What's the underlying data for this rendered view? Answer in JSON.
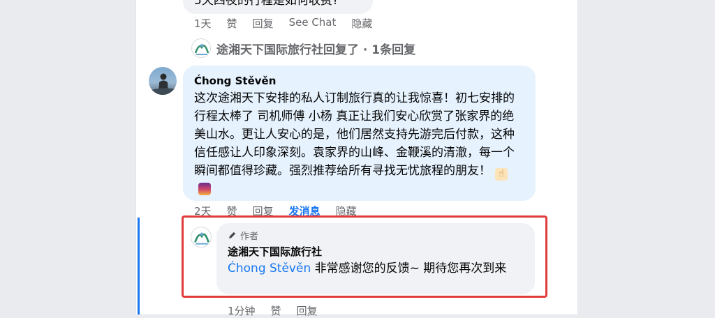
{
  "prev_comment": {
    "tail_text": "5天四夜的行程是如何收费?",
    "actions": [
      "1天",
      "赞",
      "回复",
      "See Chat",
      "隐藏"
    ]
  },
  "agency_reply_summary": {
    "text": "途湘天下国际旅行社回复了 · 1条回复",
    "avatar_icon": "agency-logo-icon"
  },
  "main_comment": {
    "author": "Ćhong Stěvěn",
    "text": "这次途湘天下安排的私人订制旅行真的让我惊喜！初七安排的行程太棒了 司机师傅 小杨 真正让我们安心欣赏了张家界的绝美山水。更让人安心的是，他们居然支持先游完后付款，这种信任感让人印象深刻。袁家界的山峰、金鞭溪的清澈，每一个瞬间都值得珍藏。强烈推荐给所有寻找无忧旅程的朋友！",
    "emojis": [
      "thumbs-up-icon",
      "sunrise-icon"
    ],
    "actions": [
      "2天",
      "赞",
      "回复",
      "发消息",
      "隐藏"
    ],
    "active_action": "发消息"
  },
  "reply": {
    "badge_icon": "pencil-icon",
    "badge_label": "作者",
    "author": "途湘天下国际旅行社",
    "mention": "Ćhong Stěvěn",
    "text": " 非常感谢您的反馈~ 期待您再次到来",
    "actions": [
      "1分钟",
      "赞",
      "回复"
    ]
  },
  "colors": {
    "link": "#1877f2",
    "highlight": "#e23b3b",
    "bubble_blue": "#e6f2fe",
    "bubble_gray": "#f0f2f5"
  }
}
